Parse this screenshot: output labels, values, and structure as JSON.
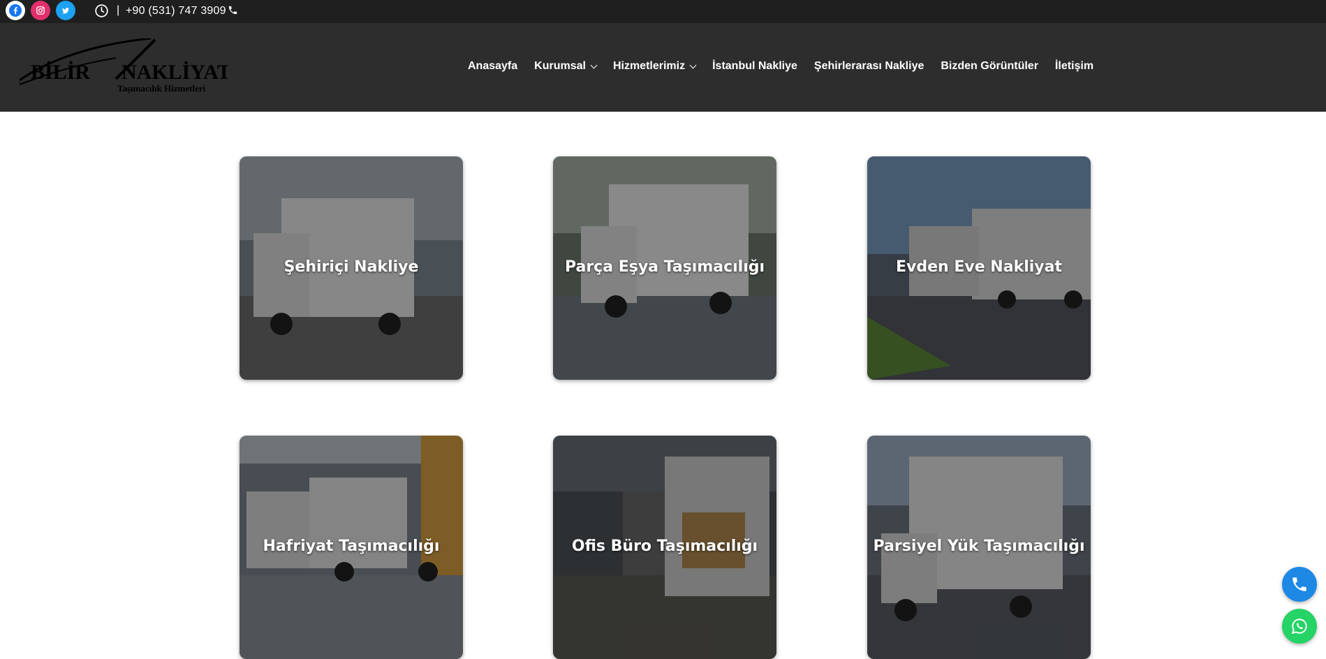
{
  "topbar": {
    "social_icons": [
      "facebook-icon",
      "instagram-icon",
      "twitter-icon"
    ],
    "separator": "|",
    "phone": "+90 (531) 747 3909"
  },
  "header": {
    "logo": {
      "name": "BİLİR",
      "name2": "NAKLİYAT",
      "tagline": "Taşımacılık Hizmetleri"
    },
    "nav": [
      {
        "label": "Anasayfa",
        "dropdown": false
      },
      {
        "label": "Kurumsal",
        "dropdown": true
      },
      {
        "label": "Hizmetlerimiz",
        "dropdown": true
      },
      {
        "label": "İstanbul Nakliye",
        "dropdown": false
      },
      {
        "label": "Şehirlerarası Nakliye",
        "dropdown": false
      },
      {
        "label": "Bizden Görüntüler",
        "dropdown": false
      },
      {
        "label": "İletişim",
        "dropdown": false
      }
    ]
  },
  "services": [
    {
      "title": "Şehiriçi Nakliye"
    },
    {
      "title": "Parça Eşya Taşımacılığı"
    },
    {
      "title": "Evden Eve Nakliyat"
    },
    {
      "title": "Hafriyat Taşımacılığı"
    },
    {
      "title": "Ofis Büro Taşımacılığı"
    },
    {
      "title": "Parsiyel Yük Taşımacılığı"
    }
  ],
  "floating": {
    "phone_icon": "phone-icon",
    "whatsapp_icon": "whatsapp-icon"
  },
  "colors": {
    "topbar": "#1f1f1f",
    "header": "#2d2d2d",
    "phone_fab": "#1e88e5",
    "whatsapp_fab": "#25d366"
  }
}
